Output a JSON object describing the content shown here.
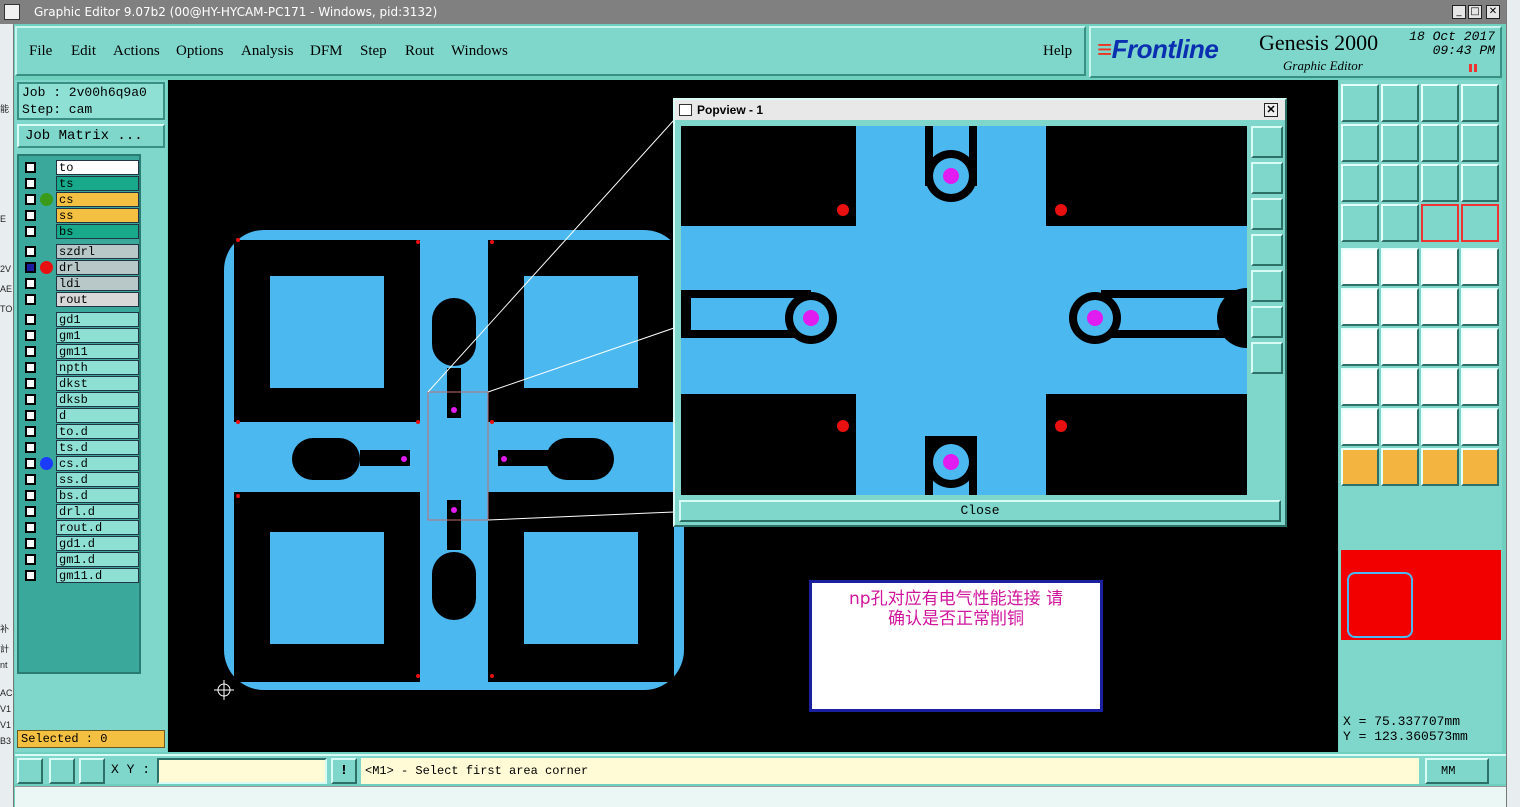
{
  "window": {
    "title": "Graphic Editor 9.07b2 (00@HY-HYCAM-PC171 - Windows, pid:3132)",
    "min": "_",
    "max": "□",
    "close": "✕"
  },
  "left_strip": [
    "能",
    "E",
    "2V",
    "AE",
    "TO",
    "nt",
    "AC",
    "V1",
    "V1",
    "B3",
    "补",
    "計"
  ],
  "menu": [
    "File",
    "Edit",
    "Actions",
    "Options",
    "Analysis",
    "DFM",
    "Step",
    "Rout",
    "Windows",
    "Help"
  ],
  "brand": {
    "logo": "Frontline",
    "product": "Genesis 2000",
    "sub": "Graphic Editor",
    "date": "18 Oct 2017",
    "time": "09:43 PM"
  },
  "job": {
    "job_line": "Job : 2v00h6q9a0",
    "step_line": "Step: cam",
    "matrix_button": "Job Matrix ..."
  },
  "layers": [
    {
      "name": "to",
      "color": "#ffffff",
      "dot": ""
    },
    {
      "name": "ts",
      "color": "#18a88a",
      "dot": ""
    },
    {
      "name": "cs",
      "color": "#f4c042",
      "dot": "#3a9a1a"
    },
    {
      "name": "ss",
      "color": "#f4c042",
      "dot": ""
    },
    {
      "name": "bs",
      "color": "#18a88a",
      "dot": ""
    },
    {
      "name": "szdrl",
      "color": "#b8c8c8",
      "dot": ""
    },
    {
      "name": "drl",
      "color": "#b8c8c8",
      "dot": "#e81010"
    },
    {
      "name": "ldi",
      "color": "#b8c8c8",
      "dot": ""
    },
    {
      "name": "rout",
      "color": "#d8d8d8",
      "dot": ""
    },
    {
      "name": "gd1",
      "color": "#8fe0d4",
      "dot": ""
    },
    {
      "name": "gm1",
      "color": "#8fe0d4",
      "dot": ""
    },
    {
      "name": "gm11",
      "color": "#8fe0d4",
      "dot": ""
    },
    {
      "name": "npth",
      "color": "#8fe0d4",
      "dot": ""
    },
    {
      "name": "dkst",
      "color": "#8fe0d4",
      "dot": ""
    },
    {
      "name": "dksb",
      "color": "#8fe0d4",
      "dot": ""
    },
    {
      "name": "d",
      "color": "#8fe0d4",
      "dot": ""
    },
    {
      "name": "to.d",
      "color": "#8fe0d4",
      "dot": ""
    },
    {
      "name": "ts.d",
      "color": "#8fe0d4",
      "dot": ""
    },
    {
      "name": "cs.d",
      "color": "#8fe0d4",
      "dot": "#1a3aff"
    },
    {
      "name": "ss.d",
      "color": "#8fe0d4",
      "dot": ""
    },
    {
      "name": "bs.d",
      "color": "#8fe0d4",
      "dot": ""
    },
    {
      "name": "drl.d",
      "color": "#8fe0d4",
      "dot": ""
    },
    {
      "name": "rout.d",
      "color": "#8fe0d4",
      "dot": ""
    },
    {
      "name": "gd1.d",
      "color": "#8fe0d4",
      "dot": ""
    },
    {
      "name": "gm1.d",
      "color": "#8fe0d4",
      "dot": ""
    },
    {
      "name": "gm11.d",
      "color": "#8fe0d4",
      "dot": ""
    }
  ],
  "selected": "Selected : 0",
  "popview": {
    "title": "Popview - 1",
    "close_label": "Close",
    "close_x": "✕"
  },
  "note": {
    "line1": "np孔对应有电气性能连接   请",
    "line2": "确认是否正常削铜"
  },
  "coords": {
    "x": "X =  75.337707mm",
    "y": "Y = 123.360573mm"
  },
  "status": {
    "xy_label": "X Y :",
    "xy_value": "",
    "excl": "!",
    "message": "<M1> - Select first area corner",
    "units": "MM"
  },
  "colors": {
    "copper": "#4cb8f0",
    "pad": "#e01cf0",
    "marker": "#e81010",
    "accent": "#7fd6cb"
  }
}
